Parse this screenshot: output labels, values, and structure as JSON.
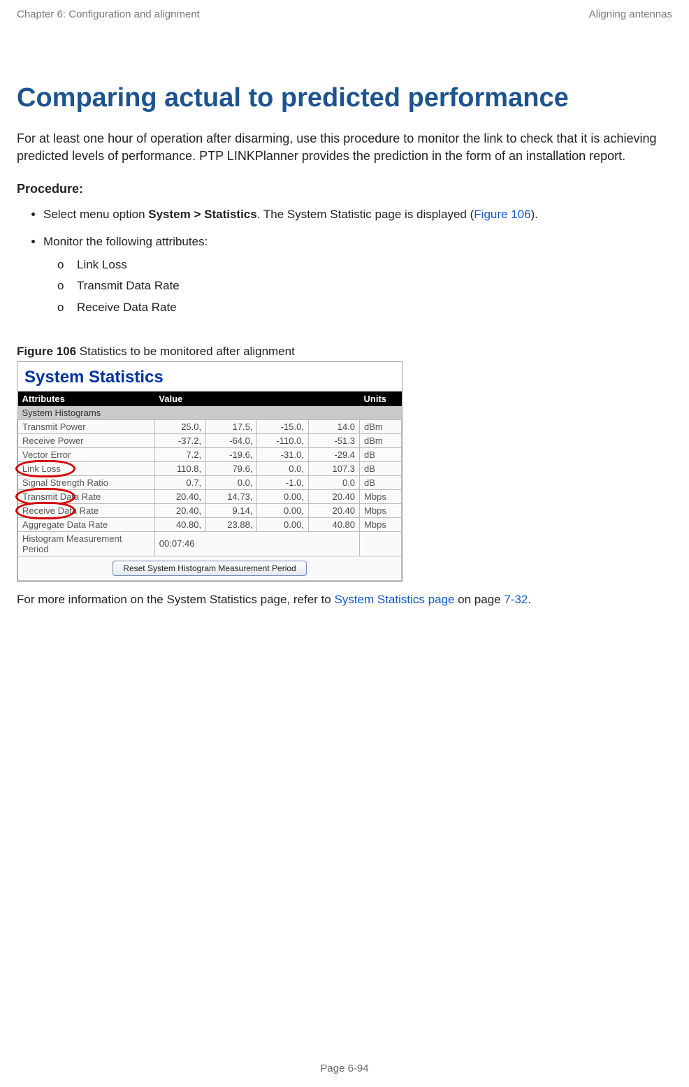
{
  "header": {
    "left": "Chapter 6:  Configuration and alignment",
    "right": "Aligning antennas"
  },
  "title": "Comparing actual to predicted performance",
  "intro": "For at least one hour of operation after disarming, use this procedure to monitor the link to check that it is achieving predicted levels of performance. PTP LINKPlanner provides the prediction in the form of an installation report.",
  "procedure_label": "Procedure:",
  "bullets": {
    "b1_pre": "Select menu option ",
    "b1_bold": "System > Statistics",
    "b1_post1": ". The System Statistic page is displayed (",
    "b1_link": "Figure 106",
    "b1_post2": ").",
    "b2": "Monitor the following attributes:",
    "sub": [
      "Link Loss",
      "Transmit Data Rate",
      "Receive Data Rate"
    ]
  },
  "figure": {
    "label_bold": "Figure 106",
    "label_rest": "  Statistics to be monitored after alignment",
    "panel_title": "System Statistics",
    "cols": {
      "attr": "Attributes",
      "val": "Value",
      "unit": "Units"
    },
    "section": "System Histograms",
    "rows": [
      {
        "attr": "Transmit Power",
        "v": [
          "25.0,",
          "17.5,",
          "-15.0,",
          "14.0"
        ],
        "unit": "dBm",
        "circ": false
      },
      {
        "attr": "Receive Power",
        "v": [
          "-37.2,",
          "-64.0,",
          "-110.0,",
          "-51.3"
        ],
        "unit": "dBm",
        "circ": false
      },
      {
        "attr": "Vector Error",
        "v": [
          "7.2,",
          "-19.6,",
          "-31.0,",
          "-29.4"
        ],
        "unit": "dB",
        "circ": false
      },
      {
        "attr": "Link Loss",
        "v": [
          "110.8,",
          "79.6,",
          "0.0,",
          "107.3"
        ],
        "unit": "dB",
        "circ": true
      },
      {
        "attr": "Signal Strength Ratio",
        "v": [
          "0.7,",
          "0.0,",
          "-1.0,",
          "0.0"
        ],
        "unit": "dB",
        "circ": false
      },
      {
        "attr": "Transmit Data Rate",
        "v": [
          "20.40,",
          "14.73,",
          "0.00,",
          "20.40"
        ],
        "unit": "Mbps",
        "circ": true
      },
      {
        "attr": "Receive Data Rate",
        "v": [
          "20.40,",
          "9.14,",
          "0.00,",
          "20.40"
        ],
        "unit": "Mbps",
        "circ": true
      },
      {
        "attr": "Aggregate Data Rate",
        "v": [
          "40.80,",
          "23.88,",
          "0.00,",
          "40.80"
        ],
        "unit": "Mbps",
        "circ": false
      }
    ],
    "hmp": {
      "attr": "Histogram Measurement Period",
      "val": "00:07:46"
    },
    "reset_button": "Reset System Histogram Measurement Period"
  },
  "after": {
    "pre": "For more information on the System Statistics page, refer to ",
    "link1": "System Statistics page",
    "mid": " on page ",
    "link2": "7-32",
    "post": "."
  },
  "footer": {
    "pre": "Page ",
    "num": "6-94"
  }
}
